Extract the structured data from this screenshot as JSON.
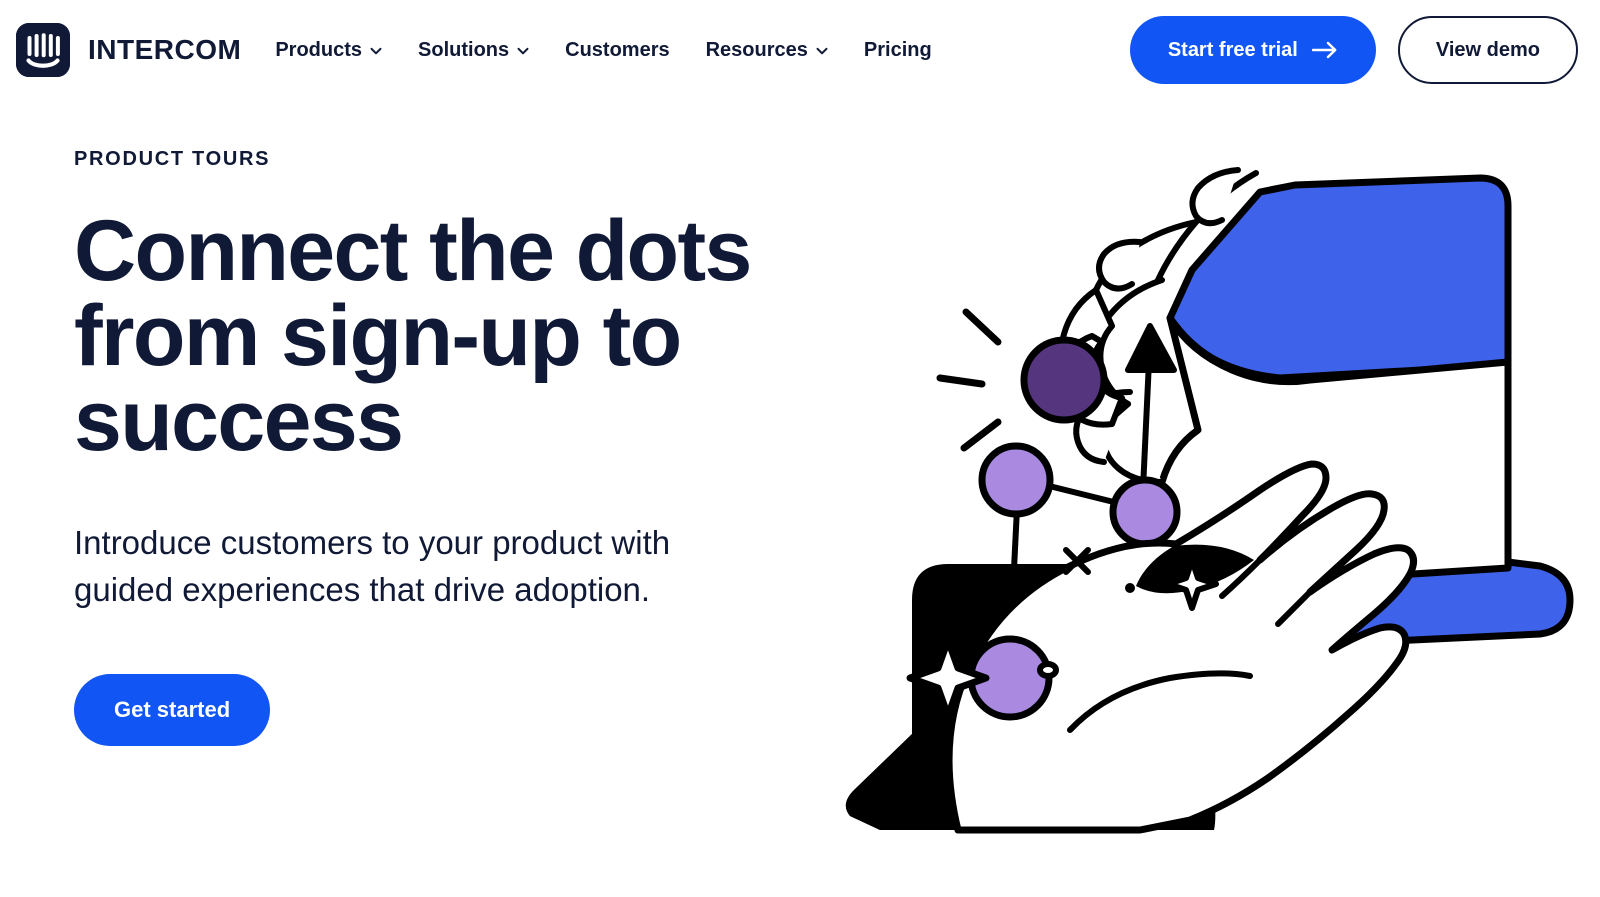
{
  "brand": {
    "name": "INTERCOM",
    "logo_icon": "intercom-logo-icon",
    "logo_color": "#101935"
  },
  "nav": {
    "items": [
      {
        "label": "Products",
        "has_dropdown": true,
        "icon": "chevron-down-icon"
      },
      {
        "label": "Solutions",
        "has_dropdown": true,
        "icon": "chevron-down-icon"
      },
      {
        "label": "Customers",
        "has_dropdown": false,
        "icon": ""
      },
      {
        "label": "Resources",
        "has_dropdown": true,
        "icon": "chevron-down-icon"
      },
      {
        "label": "Pricing",
        "has_dropdown": false,
        "icon": ""
      }
    ]
  },
  "header_actions": {
    "primary_label": "Start free trial",
    "primary_icon": "arrow-right-icon",
    "primary_color": "#1255f5",
    "secondary_label": "View demo"
  },
  "hero": {
    "eyebrow": "PRODUCT TOURS",
    "title": "Connect the dots from sign-up to success",
    "subtitle": "Introduce customers to your product with guided experiences that drive adoption.",
    "cta_label": "Get started",
    "cta_color": "#1255f5",
    "text_color": "#101935"
  },
  "illustration": {
    "name": "connect-the-dots-hands-illustration",
    "sleeve_blue": "#3f62ea",
    "sleeve_black": "#000000",
    "dot_light_purple": "#a98ae0",
    "dot_dark_purple": "#56357f",
    "stroke": "#000000"
  }
}
